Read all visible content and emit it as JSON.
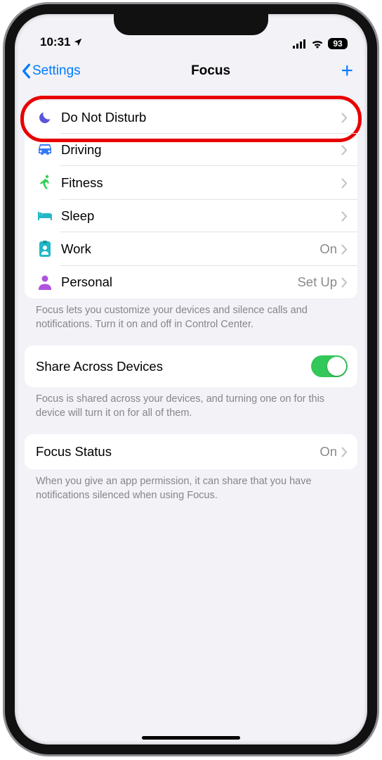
{
  "status": {
    "time": "10:31",
    "battery": "93"
  },
  "nav": {
    "back": "Settings",
    "title": "Focus"
  },
  "rows": {
    "dnd": "Do Not Disturb",
    "driving": "Driving",
    "fitness": "Fitness",
    "sleep": "Sleep",
    "work": "Work",
    "work_detail": "On",
    "personal": "Personal",
    "personal_detail": "Set Up"
  },
  "footers": {
    "focus_info": "Focus lets you customize your devices and silence calls and notifications. Turn it on and off in Control Center.",
    "share_info": "Focus is shared across your devices, and turning one on for this device will turn it on for all of them.",
    "status_info": "When you give an app permission, it can share that you have notifications silenced when using Focus."
  },
  "share": {
    "label": "Share Across Devices"
  },
  "status_row": {
    "label": "Focus Status",
    "detail": "On"
  }
}
